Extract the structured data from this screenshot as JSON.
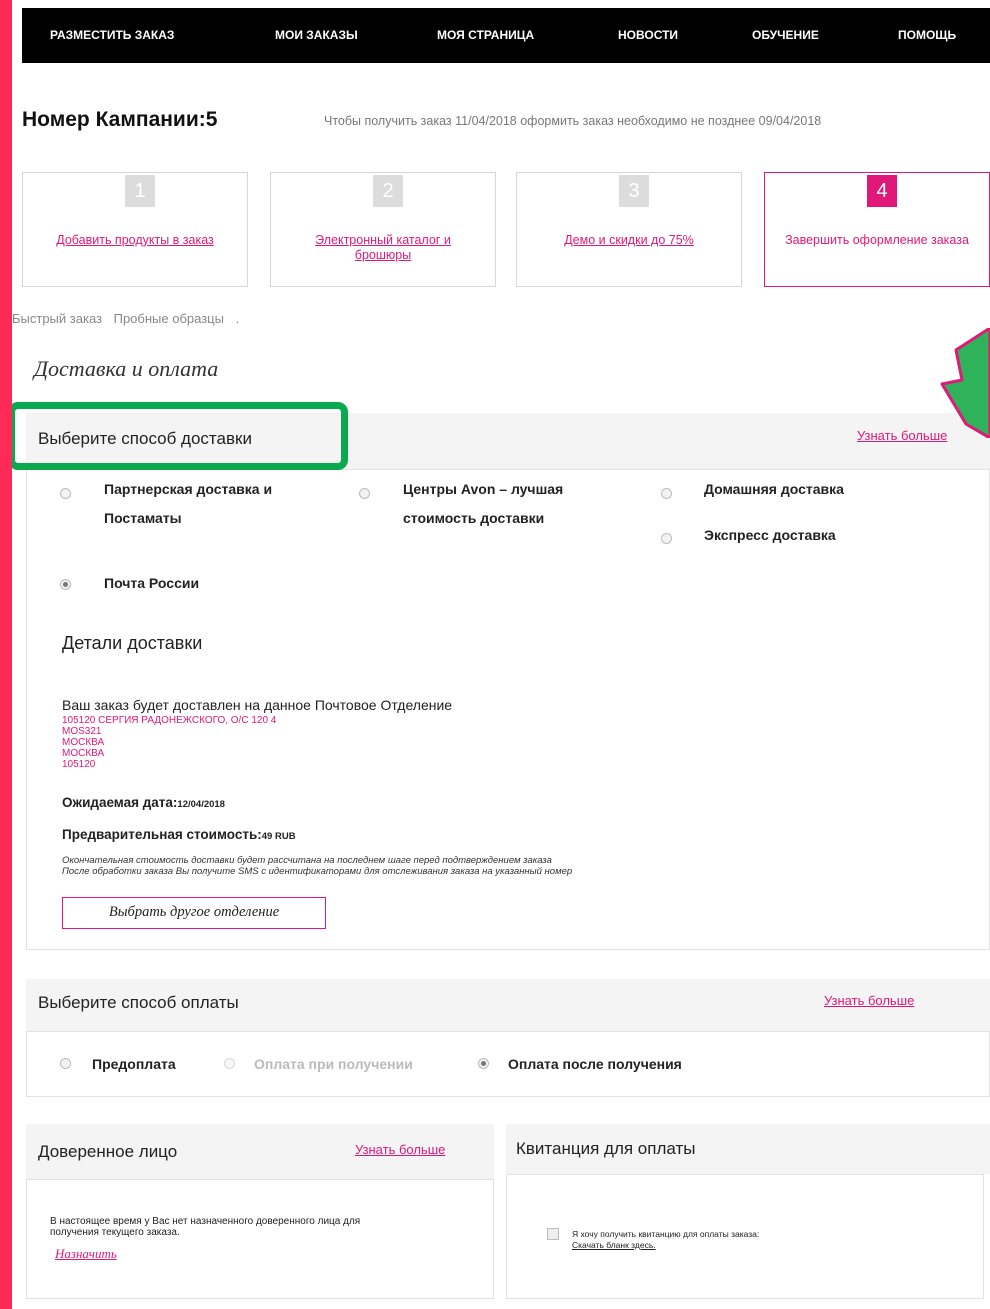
{
  "nav": {
    "items": [
      "РАЗМЕСТИТЬ ЗАКАЗ",
      "МОИ ЗАКАЗЫ",
      "МОЯ СТРАНИЦА",
      "НОВОСТИ",
      "ОБУЧЕНИЕ",
      "ПОМОЩЬ"
    ]
  },
  "header": {
    "title": "Номер Кампании:5",
    "deadline": "Чтобы получить заказ 11/04/2018 оформить заказ необходимо не позднее 09/04/2018"
  },
  "steps": [
    {
      "num": "1",
      "label": "Добавить продукты в заказ"
    },
    {
      "num": "2",
      "label": "Электронный каталог и брошюры"
    },
    {
      "num": "3",
      "label": "Демо и скидки до 75%"
    },
    {
      "num": "4",
      "label": "Завершить оформление заказа"
    }
  ],
  "subnav": {
    "quick": "Быстрый заказ",
    "samples": "Пробные образцы",
    "dot": "."
  },
  "section_title": "Доставка и оплата",
  "delivery": {
    "title": "Выберите способ доставки",
    "more": "Узнать больше",
    "options": {
      "partner_1": "Партнерская доставка и",
      "partner_2": "Постаматы",
      "avon_1": "Центры Avon – лучшая",
      "avon_2": "стоимость доставки",
      "home": "Домашняя доставка",
      "express": "Экспресс доставка",
      "post": "Почта России"
    },
    "details_title": "Детали доставки",
    "intro": "Ваш заказ будет доставлен на данное Почтовое Отделение",
    "address": [
      "105120 СЕРГИЯ РАДОНЕЖСКОГО, О/С 120 4",
      "MOS321",
      "МОСКВА",
      "МОСКВА",
      "105120"
    ],
    "expected_label": "Ожидаемая дата:",
    "expected_value": "12/04/2018",
    "cost_label": "Предварительная стоимость:",
    "cost_value": "49 RUB",
    "note_1": "Окончательная стоимость доставки будет рассчитана на последнем шаге перед подтверждением заказа",
    "note_2": "После обработки заказа Вы получите SMS с идентификаторами для отслеживания заказа на указанный номер",
    "choose_button": "Выбрать другое отделение"
  },
  "payment": {
    "title": "Выберите способ оплаты",
    "more": "Узнать больше",
    "prepay": "Предоплата",
    "on_receipt": "Оплата при получении",
    "after_receipt": "Оплата после получения"
  },
  "trustee": {
    "title": "Доверенное лицо",
    "more": "Узнать больше",
    "text_1": "В настоящее время у Вас нет назначенного доверенного лица для",
    "text_2": "получения текущего заказа.",
    "assign": "Назначить"
  },
  "receipt": {
    "title": "Квитанция для оплаты",
    "text_1": "Я хочу получить квитанцию для оплаты заказа:",
    "text_2": "Скачать бланк здесь."
  },
  "colors": {
    "accent": "#e0187a",
    "frame": "#ff2a55",
    "highlight": "#0aa84f",
    "arrow": "#2fb35a"
  }
}
